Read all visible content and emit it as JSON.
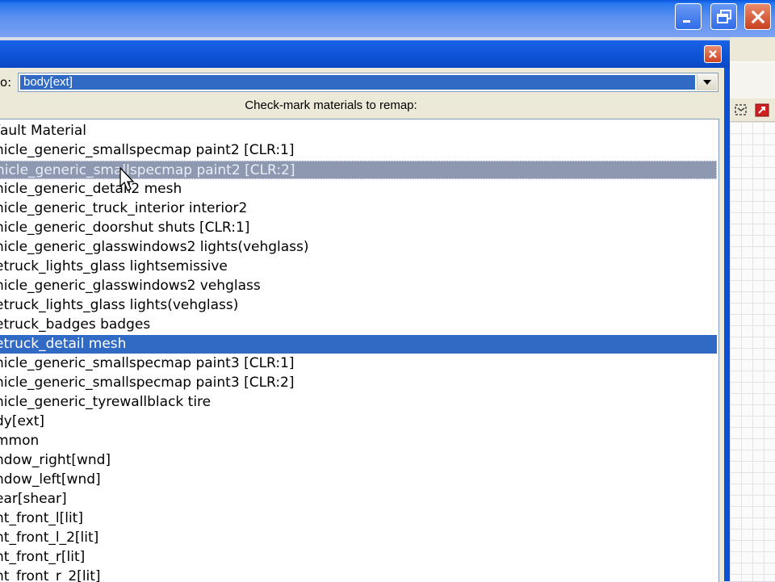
{
  "window": {
    "controls": [
      "minimize",
      "restore",
      "close"
    ]
  },
  "dialog": {
    "remap_label": "o:",
    "remap_target": "body[ext]",
    "instruction": "Check-mark materials to remap:",
    "materials": [
      {
        "label": "fault Material",
        "state": "normal"
      },
      {
        "label": "hicle_generic_smallspecmap paint2 [CLR:1]",
        "state": "normal"
      },
      {
        "label": "hicle_generic_smallspecmap paint2 [CLR:2]",
        "state": "hover"
      },
      {
        "label": "hicle_generic_detail2 mesh",
        "state": "normal"
      },
      {
        "label": "hicle_generic_truck_interior interior2",
        "state": "normal"
      },
      {
        "label": "hicle_generic_doorshut shuts [CLR:1]",
        "state": "normal"
      },
      {
        "label": "hicle_generic_glasswindows2 lights(vehglass)",
        "state": "normal"
      },
      {
        "label": "etruck_lights_glass lightsemissive",
        "state": "normal"
      },
      {
        "label": "hicle_generic_glasswindows2 vehglass",
        "state": "normal"
      },
      {
        "label": "etruck_lights_glass lights(vehglass)",
        "state": "normal"
      },
      {
        "label": "etruck_badges badges",
        "state": "normal"
      },
      {
        "label": "etruck_detail mesh",
        "state": "selected"
      },
      {
        "label": "hicle_generic_smallspecmap paint3 [CLR:1]",
        "state": "normal"
      },
      {
        "label": "hicle_generic_smallspecmap paint3 [CLR:2]",
        "state": "normal"
      },
      {
        "label": "hicle_generic_tyrewallblack tire",
        "state": "normal"
      },
      {
        "label": "dy[ext]",
        "state": "normal"
      },
      {
        "label": "mmon",
        "state": "normal"
      },
      {
        "label": "ndow_right[wnd]",
        "state": "normal"
      },
      {
        "label": "ndow_left[wnd]",
        "state": "normal"
      },
      {
        "label": "ear[shear]",
        "state": "normal"
      },
      {
        "label": "nt_front_l[lit]",
        "state": "normal"
      },
      {
        "label": "nt_front_l_2[lit]",
        "state": "normal"
      },
      {
        "label": "nt_front_r[lit]",
        "state": "normal"
      },
      {
        "label": "nt_front_r_2[lit]",
        "state": "normal"
      }
    ]
  },
  "colors": {
    "title_bar": "#2a78f0",
    "dialog_frame": "#0a4fd8",
    "selection": "#316ac5",
    "hover_selection": "#8e98b0",
    "panel": "#ece9d8"
  },
  "icons": [
    "minimize-icon",
    "restore-icon",
    "close-icon",
    "dropdown-arrow-icon",
    "crop-tool-icon",
    "red-arrow-tool-icon",
    "mouse-cursor-icon"
  ]
}
